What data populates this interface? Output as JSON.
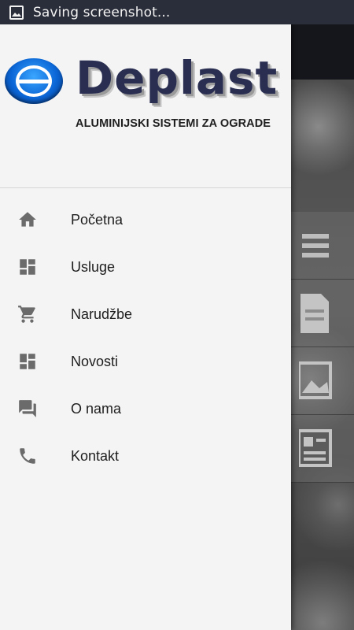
{
  "status_bar": {
    "text": "Saving screenshot..."
  },
  "drawer": {
    "logo": {
      "brand": "Deplast",
      "tagline": "ALUMINIJSKI SISTEMI ZA OGRADE"
    },
    "menu": [
      {
        "label": "Početna",
        "icon": "home-icon"
      },
      {
        "label": "Usluge",
        "icon": "dashboard-icon"
      },
      {
        "label": "Narudžbe",
        "icon": "cart-icon"
      },
      {
        "label": "Novosti",
        "icon": "dashboard-icon"
      },
      {
        "label": "O nama",
        "icon": "chat-icon"
      },
      {
        "label": "Kontakt",
        "icon": "phone-icon"
      }
    ]
  },
  "colors": {
    "drawer_bg": "#f4f4f4",
    "icon": "#6b6b6b",
    "brand_text": "#2a2f52",
    "logo_blue": "#0b66d6",
    "status_bar": "#2a2d3a"
  }
}
